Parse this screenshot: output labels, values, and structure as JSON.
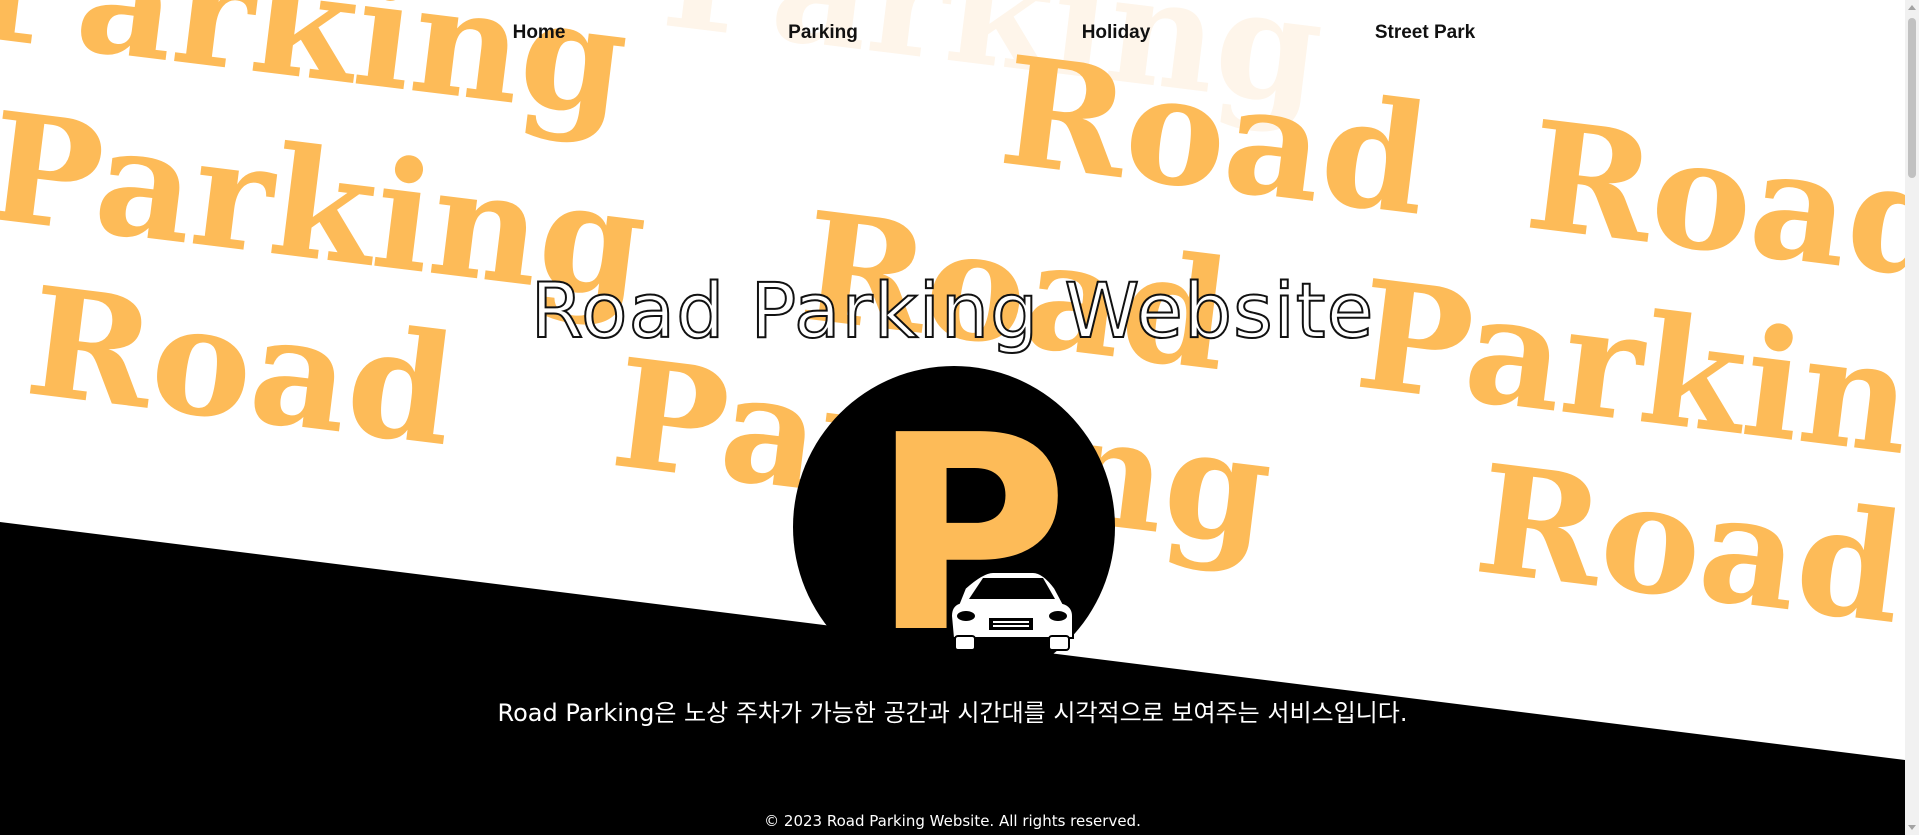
{
  "nav": {
    "items": [
      {
        "label": "Home"
      },
      {
        "label": "Parking"
      },
      {
        "label": "Holiday"
      },
      {
        "label": "Street Park"
      }
    ]
  },
  "background": {
    "word_road": "Road",
    "word_parking": "Parking"
  },
  "hero": {
    "title": "Road Parking Website",
    "logo_letter": "P",
    "description": "Road Parking은 노상 주차가 가능한 공간과 시간대를 시각적으로 보여주는 서비스입니다."
  },
  "footer": {
    "text": "© 2023 Road Parking Website. All rights reserved."
  },
  "colors": {
    "accent": "#fdbb58",
    "dark": "#000000",
    "light": "#ffffff"
  }
}
